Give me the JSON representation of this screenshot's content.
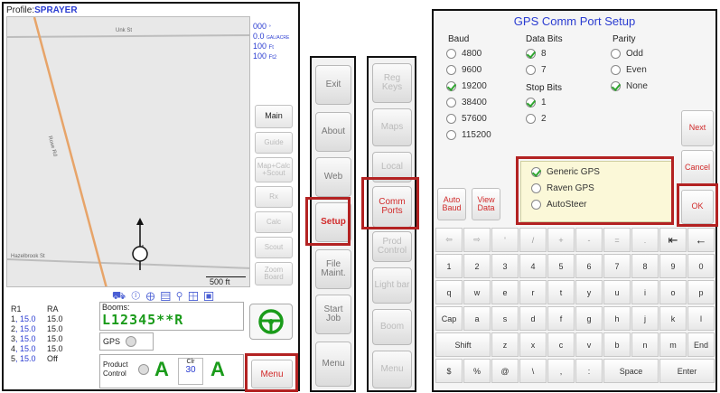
{
  "left_screen": {
    "profile_label": "Profile:",
    "profile_name": "SPRAYER",
    "readouts": [
      {
        "value": "000",
        "unit": "°"
      },
      {
        "value": "0.0",
        "unit": "GAL/ACRE"
      },
      {
        "value": "100",
        "unit": "Ft"
      },
      {
        "value": "100",
        "unit": "Ft2"
      }
    ],
    "map": {
      "road_top": "Unk St",
      "road_diagonal": "Rose Rd",
      "road_bottom": "Hazelbrook St",
      "scale": "500 ft"
    },
    "side_buttons": [
      "Main",
      "Guide",
      "Map+Calc +Scout",
      "Rx",
      "Calc",
      "Scout",
      "Zoom Board"
    ],
    "rates": [
      {
        "label": "1",
        "r1": "15.0",
        "ra": "15.0"
      },
      {
        "label": "2",
        "r1": "15.0",
        "ra": "15.0"
      },
      {
        "label": "3",
        "r1": "15.0",
        "ra": "15.0"
      },
      {
        "label": "4",
        "r1": "15.0",
        "ra": "15.0"
      },
      {
        "label": "5",
        "r1": "15.0",
        "ra": "Off"
      }
    ],
    "rate_headers": [
      "R1",
      "RA"
    ],
    "booms_label": "Booms:",
    "booms_value": "L12345**R",
    "gps_label": "GPS",
    "product_control_label": "Product Control",
    "product_mode": "A",
    "clr_label": "Clr",
    "clr_value": "30",
    "menu_button": "Menu"
  },
  "middle_menu_1": {
    "buttons": [
      "Exit",
      "About",
      "Web",
      "Setup",
      "File Maint.",
      "Start Job",
      "Menu"
    ]
  },
  "middle_menu_2": {
    "buttons": [
      "Reg Keys",
      "Maps",
      "Local",
      "Comm Ports",
      "Prod Control",
      "Light bar",
      "Boom",
      "Menu"
    ]
  },
  "gps_dialog": {
    "title": "GPS Comm Port Setup",
    "baud_label": "Baud",
    "baud_options": [
      "4800",
      "9600",
      "19200",
      "38400",
      "57600",
      "115200"
    ],
    "baud_selected": "19200",
    "data_bits_label": "Data Bits",
    "data_bits_options": [
      "8",
      "7"
    ],
    "stop_bits_label": "Stop Bits",
    "stop_bits_options": [
      "1",
      "2"
    ],
    "parity_label": "Parity",
    "parity_options": [
      "Odd",
      "Even",
      "None"
    ],
    "gps_type_options": [
      "Generic GPS",
      "Raven GPS",
      "AutoSteer"
    ],
    "auto_baud": "Auto Baud",
    "view_data": "View Data",
    "next": "Next",
    "cancel": "Cancel",
    "ok": "OK",
    "keyboard": {
      "row0": [
        "⇦",
        "⇨",
        "'",
        "/",
        "+",
        "-",
        "=",
        ".",
        "⇤",
        "←"
      ],
      "row1": [
        "1",
        "2",
        "3",
        "4",
        "5",
        "6",
        "7",
        "8",
        "9",
        "0"
      ],
      "row2": [
        "q",
        "w",
        "e",
        "r",
        "t",
        "y",
        "u",
        "i",
        "o",
        "p"
      ],
      "row3": [
        "Cap",
        "a",
        "s",
        "d",
        "f",
        "g",
        "h",
        "j",
        "k",
        "l"
      ],
      "row4": [
        "Shift",
        "z",
        "x",
        "c",
        "v",
        "b",
        "n",
        "m",
        "End"
      ],
      "row5": [
        "$",
        "%",
        "@",
        "\\",
        ",",
        ":",
        "Space",
        "Enter"
      ]
    }
  },
  "colors": {
    "accent_red": "#b32222",
    "title_blue": "#2a3cd1",
    "check_green": "#2fa52f"
  }
}
